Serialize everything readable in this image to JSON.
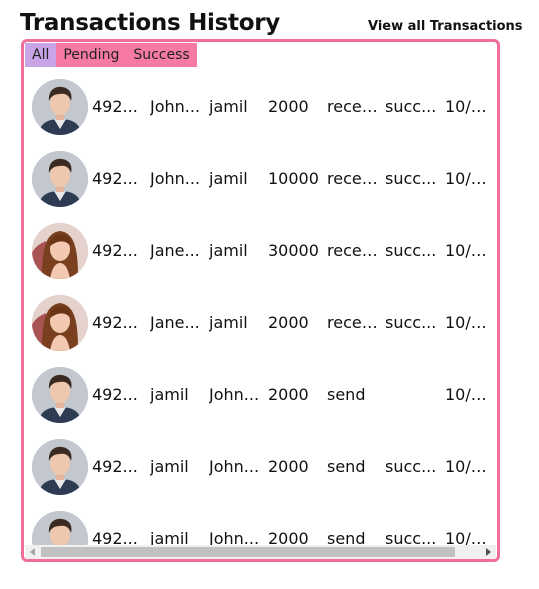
{
  "header": {
    "title": "Transactions History",
    "view_all": "View all Transactions"
  },
  "tabs": [
    {
      "label": "All",
      "active": true
    },
    {
      "label": "Pending",
      "active": false
    },
    {
      "label": "Success",
      "active": false
    }
  ],
  "colors": {
    "border": "#f06f98",
    "tab": "#f77aa6",
    "tab_active": "#c9a4e6"
  },
  "transactions": [
    {
      "avatar": "male-avatar",
      "id": "492...",
      "from": "John...",
      "to": "jamil",
      "amount": "2000",
      "type": "recei...",
      "status": "succ...",
      "date": "10/7..."
    },
    {
      "avatar": "male-avatar",
      "id": "492...",
      "from": "John...",
      "to": "jamil",
      "amount": "10000",
      "type": "recei...",
      "status": "succ...",
      "date": "10/7..."
    },
    {
      "avatar": "female-avatar",
      "id": "492...",
      "from": "Jane...",
      "to": "jamil",
      "amount": "30000",
      "type": "recei...",
      "status": "succ...",
      "date": "10/7..."
    },
    {
      "avatar": "female-avatar",
      "id": "492...",
      "from": "Jane...",
      "to": "jamil",
      "amount": "2000",
      "type": "recei...",
      "status": "succ...",
      "date": "10/7..."
    },
    {
      "avatar": "male-avatar",
      "id": "492...",
      "from": "jamil",
      "to": "John...",
      "amount": "2000",
      "type": "send",
      "status": "",
      "date": "10/7..."
    },
    {
      "avatar": "male-avatar",
      "id": "492...",
      "from": "jamil",
      "to": "John...",
      "amount": "2000",
      "type": "send",
      "status": "succ...",
      "date": "10/7..."
    },
    {
      "avatar": "male-avatar",
      "id": "492...",
      "from": "jamil",
      "to": "John...",
      "amount": "2000",
      "type": "send",
      "status": "succ...",
      "date": "10/7..."
    }
  ]
}
